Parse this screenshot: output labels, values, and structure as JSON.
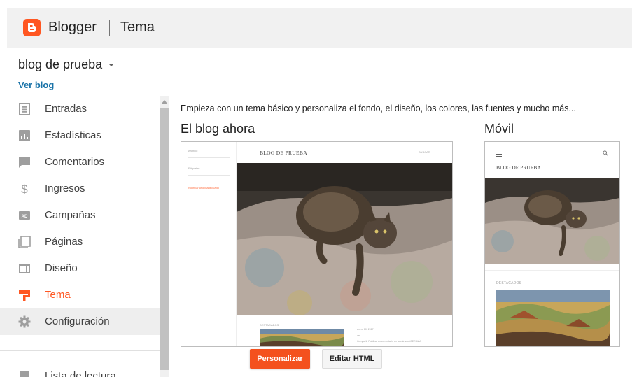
{
  "header": {
    "brand": "Blogger",
    "section": "Tema"
  },
  "blog": {
    "name": "blog de prueba",
    "view_link": "Ver blog"
  },
  "sidebar": {
    "items": [
      {
        "label": "Entradas",
        "icon": "posts-icon"
      },
      {
        "label": "Estadísticas",
        "icon": "stats-icon"
      },
      {
        "label": "Comentarios",
        "icon": "comments-icon"
      },
      {
        "label": "Ingresos",
        "icon": "earnings-icon"
      },
      {
        "label": "Campañas",
        "icon": "campaigns-icon"
      },
      {
        "label": "Páginas",
        "icon": "pages-icon"
      },
      {
        "label": "Diseño",
        "icon": "layout-icon"
      },
      {
        "label": "Tema",
        "icon": "theme-icon",
        "selected": true
      },
      {
        "label": "Configuración",
        "icon": "settings-icon",
        "hovered": true
      },
      {
        "label": "Lista de lectura",
        "icon": "reading-list-icon"
      }
    ]
  },
  "main": {
    "intro": "Empieza con un tema básico y personaliza el fondo, el diseño, los colores, las fuentes y mucho más...",
    "current_heading": "El blog ahora",
    "mobile_heading": "Móvil",
    "desktop_preview": {
      "blog_title": "BLOG DE PRUEBA",
      "search": "BUSCAR",
      "side_rows": [
        "Archivo",
        "Etiquetas"
      ],
      "side_link": "Notificar uso inadecuado",
      "featured": "DESTACADOS",
      "meta_date": "enero 10, 2017",
      "meta_author": "de",
      "meta_share": "Compartir    Publicar un comentario en la entrada  LEER MÁS"
    },
    "mobile_preview": {
      "blog_title": "BLOG DE PRUEBA",
      "featured": "DESTACADOS"
    }
  },
  "buttons": {
    "customize": "Personalizar",
    "edit_html": "Editar HTML"
  },
  "colors": {
    "accent": "#ff5722",
    "link": "#1a73a8",
    "header_bg": "#f1f1f1"
  }
}
